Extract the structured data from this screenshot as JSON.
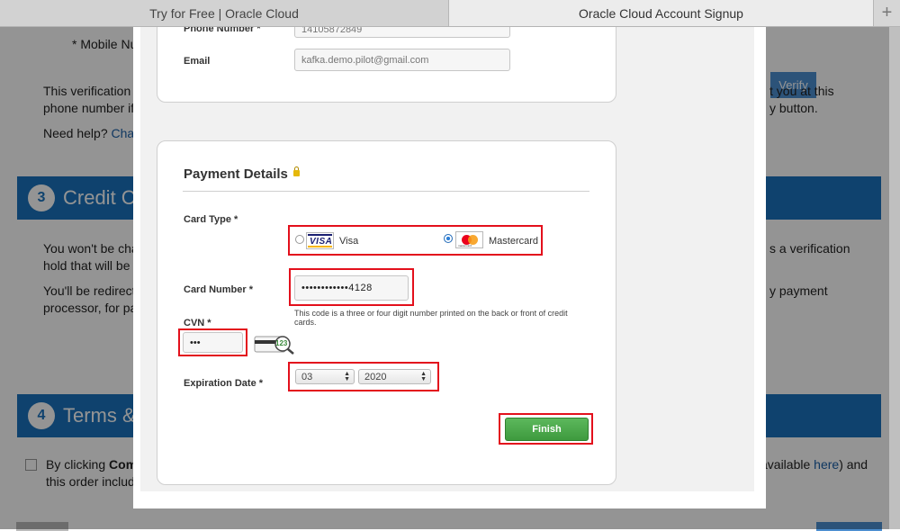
{
  "browser": {
    "tabs": [
      {
        "label": "Try for Free | Oracle Cloud"
      },
      {
        "label": "Oracle Cloud Account Signup"
      }
    ],
    "new_tab_glyph": "+"
  },
  "background": {
    "mobile_label": "* Mobile Nu",
    "verify_label": "Verify",
    "verification_line1_left": "This verification c",
    "verification_line1_right": "t you at this",
    "verification_line2_left": "phone number if",
    "verification_line2_right": "y button.",
    "need_help": "Need help?",
    "chat_link": "Chat",
    "section3_num": "3",
    "section3_title": "Credit C",
    "charge_line1_left": "You won't be cha",
    "charge_line1_right": "s a verification",
    "charge_line2_left": "hold that will be r",
    "redirect_line1_left": "You'll be redirect",
    "redirect_line1_right": "y payment",
    "redirect_line2_left": "processor, for pa",
    "section4_num": "4",
    "section4_title": "Terms &",
    "terms_left_prefix": "By clicking ",
    "terms_left_bold": "Com",
    "terms_right_prefix": "available ",
    "terms_right_link": "here",
    "terms_right_suffix": ") and",
    "terms_line2_left": "this order includi"
  },
  "modal": {
    "contact": {
      "phone_label": "Phone Number *",
      "phone_value": "14105872849",
      "email_label": "Email",
      "email_value": "kafka.demo.pilot@gmail.com"
    },
    "payment": {
      "title": "Payment Details",
      "card_type_label": "Card Type *",
      "card_types": [
        {
          "label": "Visa",
          "logo_text": "VISA",
          "selected": false
        },
        {
          "label": "Mastercard",
          "logo_text": "mastercard",
          "selected": true
        }
      ],
      "card_number_label": "Card Number *",
      "card_number_value": "••••••••••••4128",
      "cvn_helper": "This code is a three or four digit number printed on the back or front of credit cards.",
      "cvn_label": "CVN *",
      "cvn_value": "•••",
      "cvn_image_text": "123",
      "expiration_label": "Expiration Date *",
      "exp_month": "03",
      "exp_year": "2020",
      "finish_label": "Finish"
    }
  },
  "colors": {
    "section_bar": "#1a73be",
    "finish_green": "#4aa84a",
    "highlight_red": "#e3101c"
  }
}
